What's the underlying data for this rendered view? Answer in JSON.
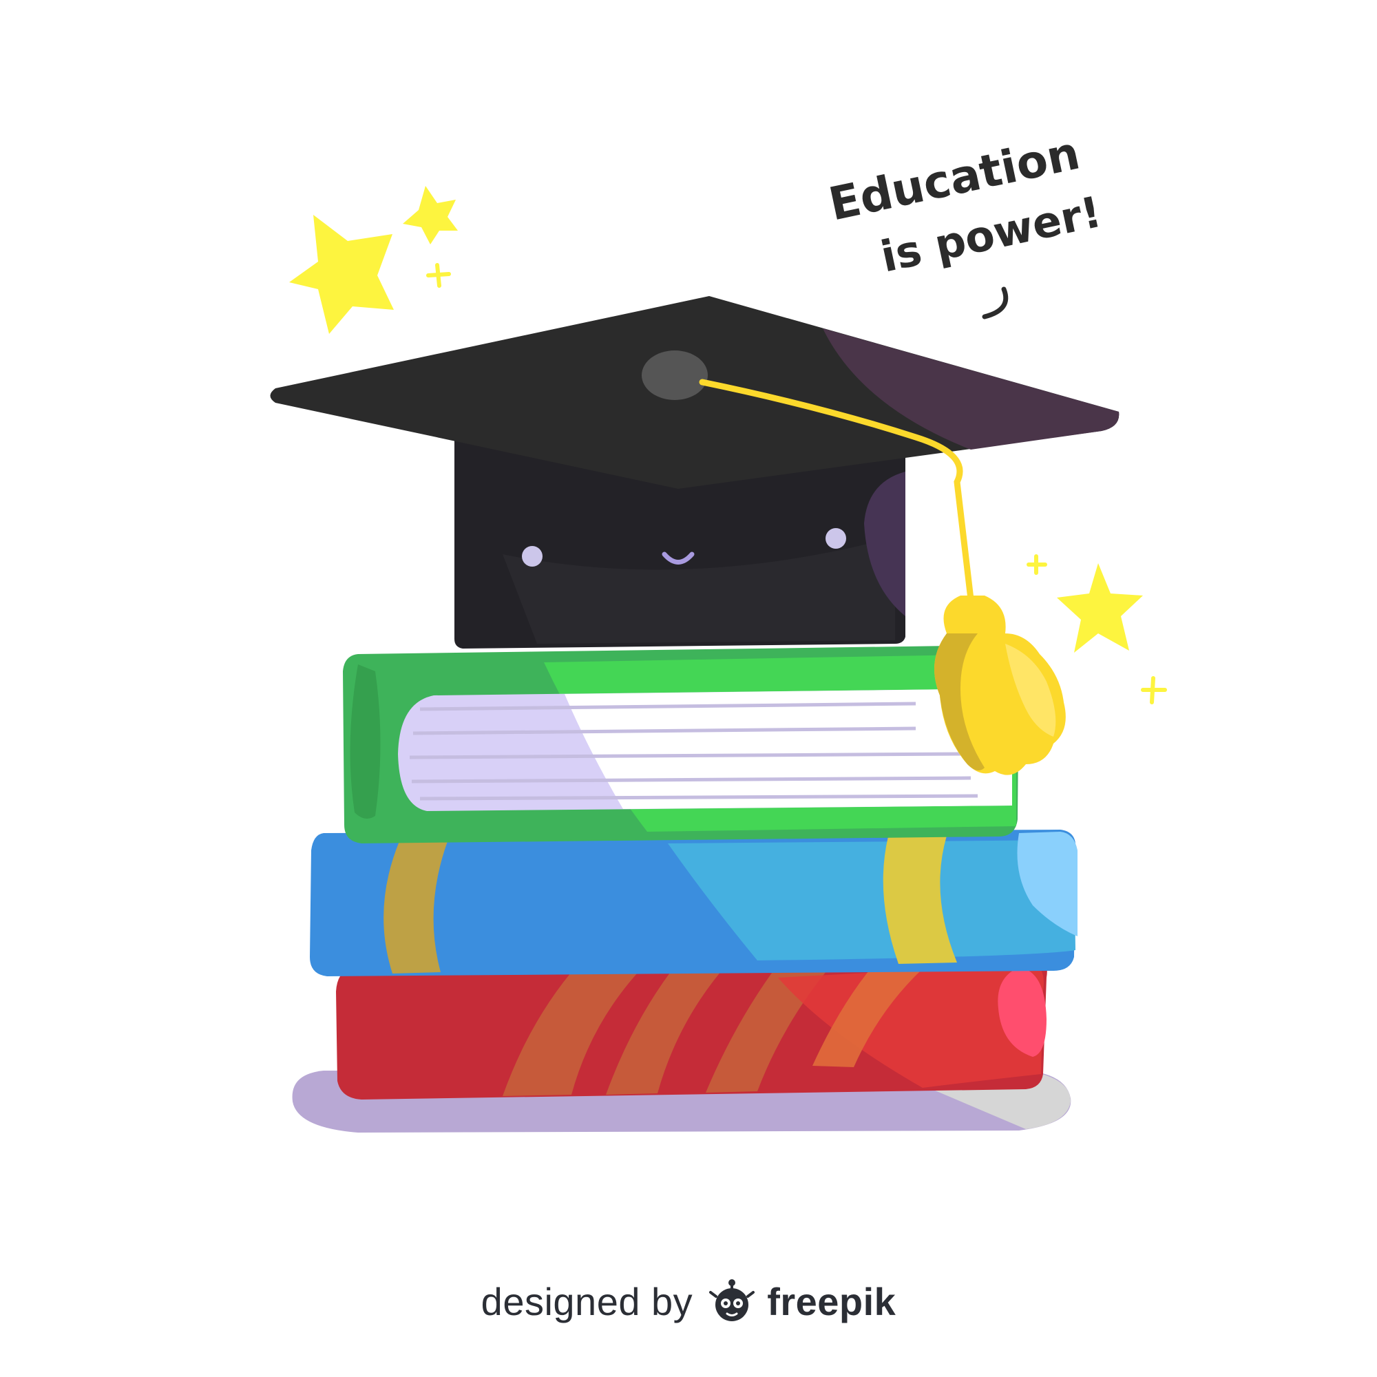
{
  "caption": {
    "line1": "Education",
    "line2": "is power!"
  },
  "credit": {
    "prefix": "designed by",
    "brand": "freepik"
  },
  "colors": {
    "cap": "#232227",
    "tassel": "#fcd92c",
    "stars": "#fdf43f",
    "book_green": "#3eb35a",
    "book_blue": "#3b8ede",
    "book_red": "#c52c38",
    "shadow": "#b8a8d4"
  },
  "icons": [
    "star-icon",
    "sparkle-icon",
    "freepik-logo-icon"
  ]
}
